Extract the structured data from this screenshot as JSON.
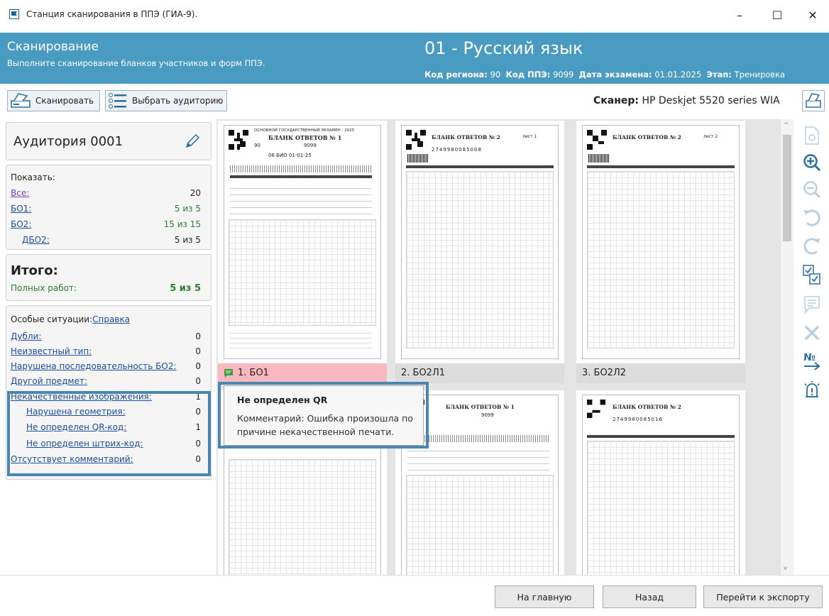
{
  "window": {
    "title": "Станция сканирования в ППЭ (ГИА-9).",
    "minimize": "–",
    "maximize": "☐",
    "close": "✕"
  },
  "header": {
    "title": "Сканирование",
    "subtitle": "Выполните сканирование бланков участников и форм ППЭ.",
    "subject": "01 - Русский язык",
    "region_label": "Код региона:",
    "region_value": "90",
    "ppe_label": "Код ППЭ:",
    "ppe_value": "9099",
    "date_label": "Дата экзамена:",
    "date_value": "01.01.2025",
    "stage_label": "Этап:",
    "stage_value": "Тренировка"
  },
  "toolbar": {
    "scan_label": "Сканировать",
    "choose_room_label": "Выбрать аудиторию",
    "scanner_label": "Сканер:",
    "scanner_value": "HP Deskjet 5520 series WIA"
  },
  "left": {
    "room_title": "Аудитория 0001",
    "show_title": "Показать:",
    "show_items": [
      {
        "label": "Все:",
        "value": "20"
      },
      {
        "label": "БО1:",
        "value": "5 из 5"
      },
      {
        "label": "БО2:",
        "value": "15 из 15"
      },
      {
        "label": "ДБО2:",
        "value": "5 из 5"
      }
    ],
    "total_title": "Итого:",
    "full_label": "Полных работ:",
    "full_value": "5 из 5",
    "special_title": "Особые ситуации:",
    "special_help": "Справка",
    "special_items": [
      {
        "label": "Дубли:",
        "value": "0"
      },
      {
        "label": "Неизвестный тип:",
        "value": "0"
      },
      {
        "label": "Нарушена последовательность БО2:",
        "value": "0"
      },
      {
        "label": "Другой предмет:",
        "value": "0"
      },
      {
        "label": "Некачественные изображения:",
        "value": "1"
      },
      {
        "label": "Нарушена геометрия:",
        "value": "0"
      },
      {
        "label": "Не определен QR-код:",
        "value": "1"
      },
      {
        "label": "Не определен штрих-код:",
        "value": "0"
      },
      {
        "label": "Отсутствует комментарий:",
        "value": "0"
      }
    ]
  },
  "thumbs": [
    {
      "caption": "1. БО1",
      "form_title": "БЛАНК ОТВЕТОВ № 1",
      "code": "9099",
      "region": "90",
      "date": "06 БИО 01-01-25"
    },
    {
      "caption": "2. БО2Л1",
      "form_title": "БЛАНК ОТВЕТОВ № 2",
      "sheet": "лист 1",
      "barcode": "2749980085008"
    },
    {
      "caption": "3. БО2Л2",
      "form_title": "БЛАНК ОТВЕТОВ № 2",
      "sheet": "лист 2",
      "barcode": ""
    }
  ],
  "row2": [
    {
      "form_title": "БЛАНК ОТВЕТОВ № 1",
      "code": "9099"
    },
    {
      "form_title": "БЛАНК ОТВЕТОВ № 2",
      "barcode": "2749980085016"
    }
  ],
  "form_header": "ОСНОВНОЙ ГОСУДАРСТВЕННЫЙ ЭКЗАМЕН - 2025",
  "tooltip": {
    "title": "Не определен QR",
    "text": "Комментарий: Ошибка произошла по причине некачественной печати."
  },
  "bottom": {
    "home": "На главную",
    "back": "Назад",
    "export": "Перейти к экспорту"
  },
  "colors": {
    "header": "#4a9bc2",
    "error": "#f8b8c0",
    "highlight": "#4a86b0",
    "ok": "#2e7d32"
  }
}
